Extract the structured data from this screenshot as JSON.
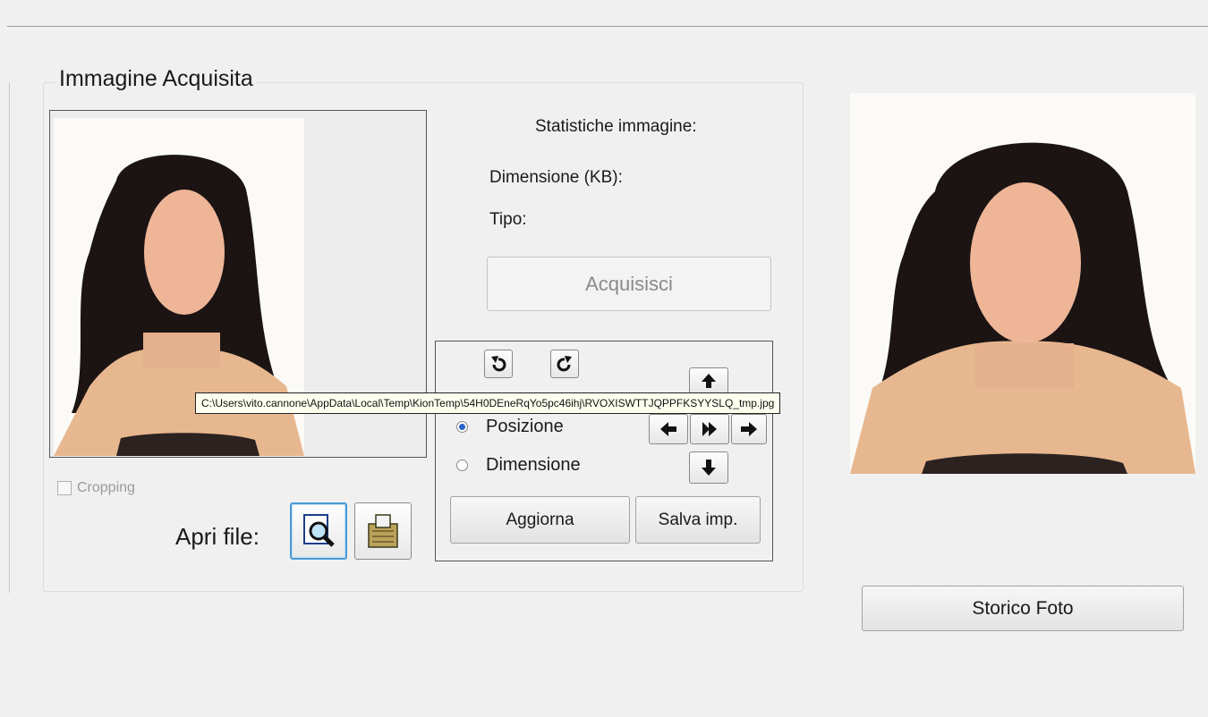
{
  "group": {
    "title": "Immagine Acquisita"
  },
  "stats": {
    "title": "Statistiche immagine:",
    "size_label": "Dimensione (KB):",
    "type_label": "Tipo:"
  },
  "buttons": {
    "acquire": "Acquisisci",
    "update": "Aggiorna",
    "save_settings": "Salva imp.",
    "photo_history": "Storico Foto"
  },
  "adjust": {
    "mode_options": [
      {
        "label": "Posizione",
        "selected": true
      },
      {
        "label": "Dimensione",
        "selected": false
      }
    ]
  },
  "cropping": {
    "label": "Cropping",
    "checked": false,
    "enabled": false
  },
  "open_file": {
    "label": "Apri file:"
  },
  "tooltip": {
    "text": "C:\\Users\\vito.cannone\\AppData\\Local\\Temp\\KionTemp\\54H0DEneRqYo5pc46ihj\\RVOXISWTTJQPPFKSYYSLQ_tmp.jpg"
  },
  "icons": [
    "rotate-left-icon",
    "rotate-right-icon",
    "arrow-up-icon",
    "arrow-down-icon",
    "arrow-left-icon",
    "arrow-right-icon",
    "center-icon",
    "open-file-magnifier-icon",
    "scanner-icon"
  ],
  "colors": {
    "window_bg": "#f0f0f0",
    "focus_border": "#4a9ad4",
    "tooltip_bg": "#fffff0"
  }
}
